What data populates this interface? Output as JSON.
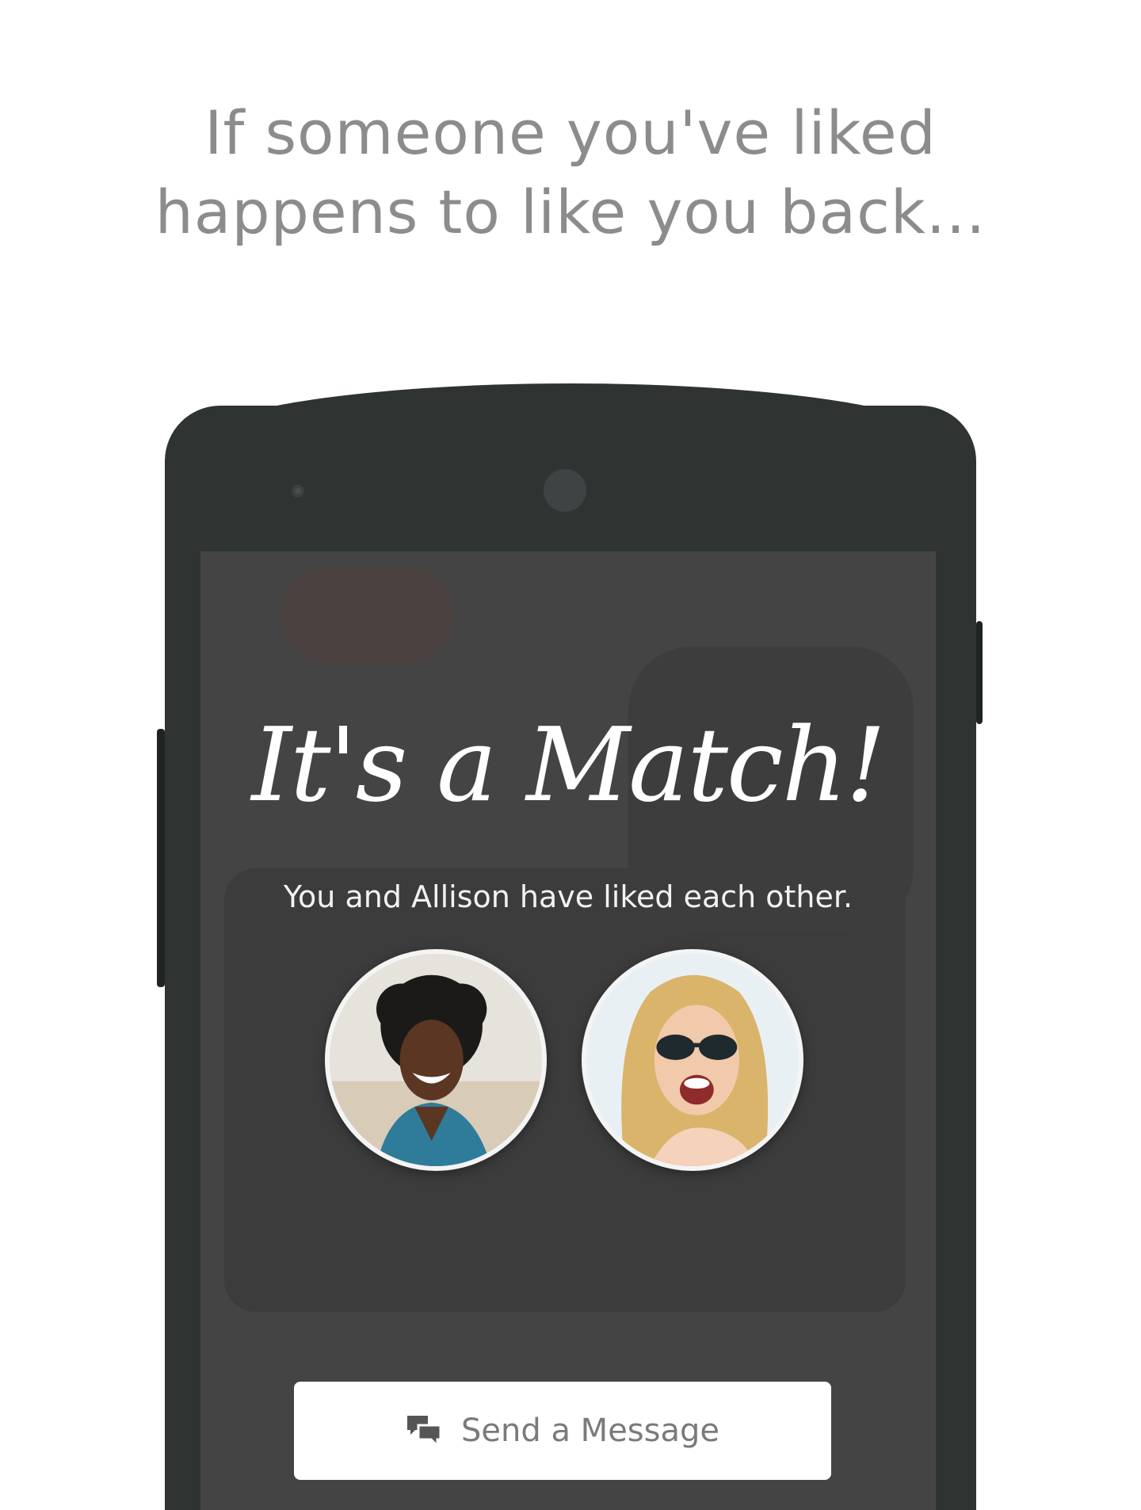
{
  "intro": {
    "line1": "If someone you've liked",
    "line2": "happens to like you back..."
  },
  "match_screen": {
    "title": "It's a Match!",
    "subtitle": "You and Allison have liked each other.",
    "avatars": [
      {
        "icon": "user-photo-man"
      },
      {
        "icon": "user-photo-woman-sunglasses"
      }
    ],
    "send_button": {
      "label": "Send a Message",
      "icon": "chat-bubbles-icon"
    }
  },
  "colors": {
    "phone_body": "#2f3433",
    "screen_bg": "#454444",
    "headline_text": "#8c8c8c",
    "button_bg": "#ffffff"
  }
}
